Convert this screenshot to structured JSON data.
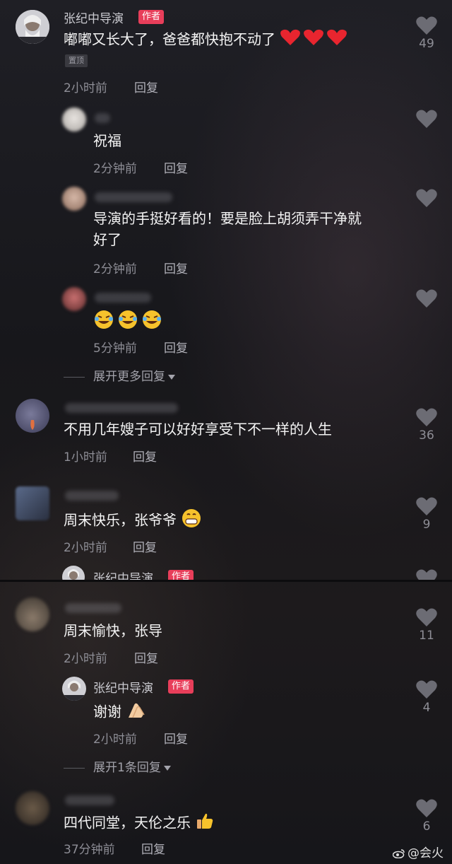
{
  "author": {
    "name": "张纪中导演",
    "tag": "作者",
    "pin_label": "置顶"
  },
  "reply_label": "回复",
  "comments": [
    {
      "text": "嘟嘟又长大了，爸爸都快抱不动了",
      "emoji": "heart-emoji x3",
      "time": "2小时前",
      "likes": "49"
    },
    {
      "text": "祝福",
      "time": "2分钟前"
    },
    {
      "text_line1": "导演的手挺好看的！要是脸上胡须弄干净就",
      "text_line2": "好了",
      "time": "2分钟前"
    },
    {
      "emoji": "rolling-laughing-emoji x3",
      "time": "5分钟前"
    },
    {
      "text": "不用几年嫂子可以好好享受下不一样的人生",
      "time": "1小时前",
      "likes": "36"
    },
    {
      "text": "周末快乐，张爷爷",
      "emoji": "grinning-emoji",
      "time": "2小时前",
      "likes": "9"
    },
    {
      "text": "周末愉快，张导",
      "time": "2小时前",
      "likes": "11"
    },
    {
      "text": "谢谢",
      "emoji": "clapping-hands-emoji",
      "time": "2小时前",
      "likes": "4"
    },
    {
      "text": "四代同堂，天伦之乐",
      "emoji": "thumbs-up-emoji",
      "time": "37分钟前",
      "likes": "6"
    }
  ],
  "expand": {
    "more": "展开更多回复",
    "one": "展开1条回复"
  },
  "watermark": "@会火",
  "colors": {
    "tag": "#e83e5a",
    "heart_emoji": "#e8252f",
    "background": "#1b1b20"
  }
}
